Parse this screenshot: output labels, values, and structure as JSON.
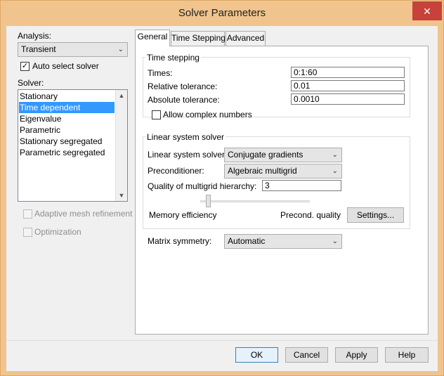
{
  "window": {
    "title": "Solver Parameters",
    "close_glyph": "✕"
  },
  "left": {
    "analysis_label": "Analysis:",
    "analysis_value": "Transient",
    "auto_select_label": "Auto select solver",
    "auto_select_checked": true,
    "solver_label": "Solver:",
    "solvers": [
      {
        "label": "Stationary",
        "selected": false
      },
      {
        "label": "Time dependent",
        "selected": true
      },
      {
        "label": "Eigenvalue",
        "selected": false
      },
      {
        "label": "Parametric",
        "selected": false
      },
      {
        "label": "Stationary segregated",
        "selected": false
      },
      {
        "label": "Parametric segregated",
        "selected": false
      }
    ],
    "adaptive_label": "Adaptive mesh refinement",
    "optimization_label": "Optimization"
  },
  "tabs": [
    {
      "label": "General",
      "active": true
    },
    {
      "label": "Time Stepping",
      "active": false
    },
    {
      "label": "Advanced",
      "active": false
    }
  ],
  "general": {
    "time_stepping": {
      "title": "Time stepping",
      "times_label": "Times:",
      "times_value": "0:1:60",
      "rel_tol_label": "Relative tolerance:",
      "rel_tol_value": "0.01",
      "abs_tol_label": "Absolute tolerance:",
      "abs_tol_value": "0.0010",
      "allow_complex_label": "Allow complex numbers",
      "allow_complex_checked": false
    },
    "linear": {
      "title": "Linear system solver",
      "solver_label": "Linear system solver:",
      "solver_value": "Conjugate gradients",
      "precond_label": "Preconditioner:",
      "precond_value": "Algebraic multigrid",
      "quality_label": "Quality of multigrid hierarchy:",
      "quality_value": "3",
      "slider_min_label": "Memory efficiency",
      "slider_max_label": "Precond. quality",
      "settings_button": "Settings..."
    },
    "matrix_label": "Matrix symmetry:",
    "matrix_value": "Automatic"
  },
  "buttons": {
    "ok": "OK",
    "cancel": "Cancel",
    "apply": "Apply",
    "help": "Help"
  },
  "icons": {
    "dropdown": "chevron-down-icon",
    "check": "checkmark-icon"
  }
}
